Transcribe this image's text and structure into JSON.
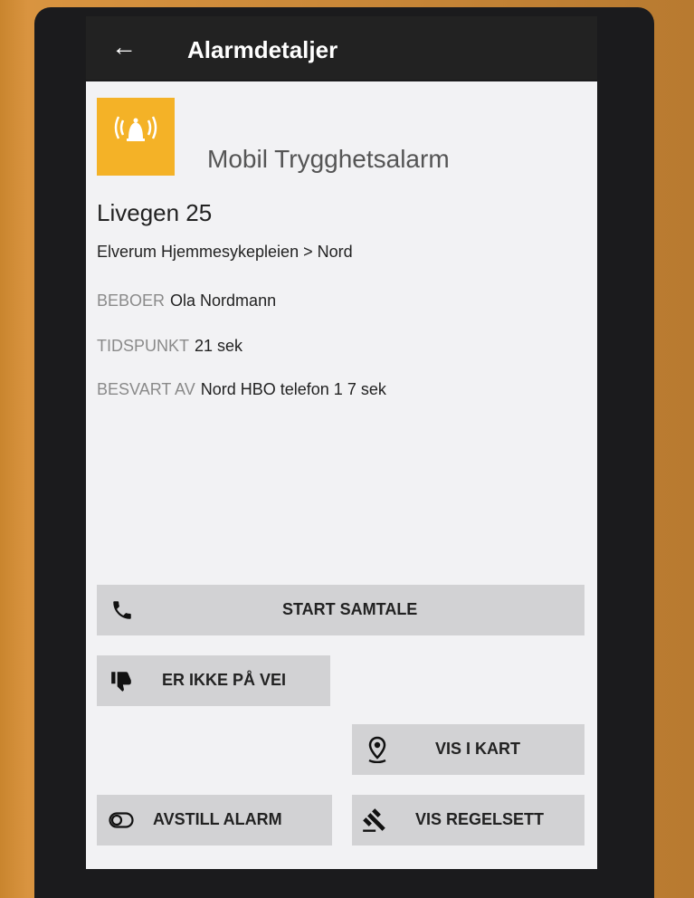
{
  "header": {
    "title": "Alarmdetaljer",
    "back_icon": "arrow-left-icon"
  },
  "alarm": {
    "type": "Mobil Trygghetsalarm",
    "icon": "alarm-bell-icon",
    "address": "Livegen 25",
    "organization": "Elverum Hjemmesykepleien > Nord"
  },
  "details": [
    {
      "label": "BEBOER",
      "value": "Ola Nordmann"
    },
    {
      "label": "TIDSPUNKT",
      "value": "21 sek"
    },
    {
      "label": "BESVART AV",
      "value": "Nord HBO telefon 1 7 sek"
    }
  ],
  "actions": {
    "start_call": "START SAMTALE",
    "not_on_way": "ER IKKE PÅ VEI",
    "show_map": "VIS I KART",
    "cancel_alarm": "AVSTILL ALARM",
    "show_rules": "VIS REGELSETT"
  },
  "colors": {
    "accent": "#f4b227",
    "button_bg": "#d2d2d4",
    "label_gray": "#8a8a8a"
  }
}
